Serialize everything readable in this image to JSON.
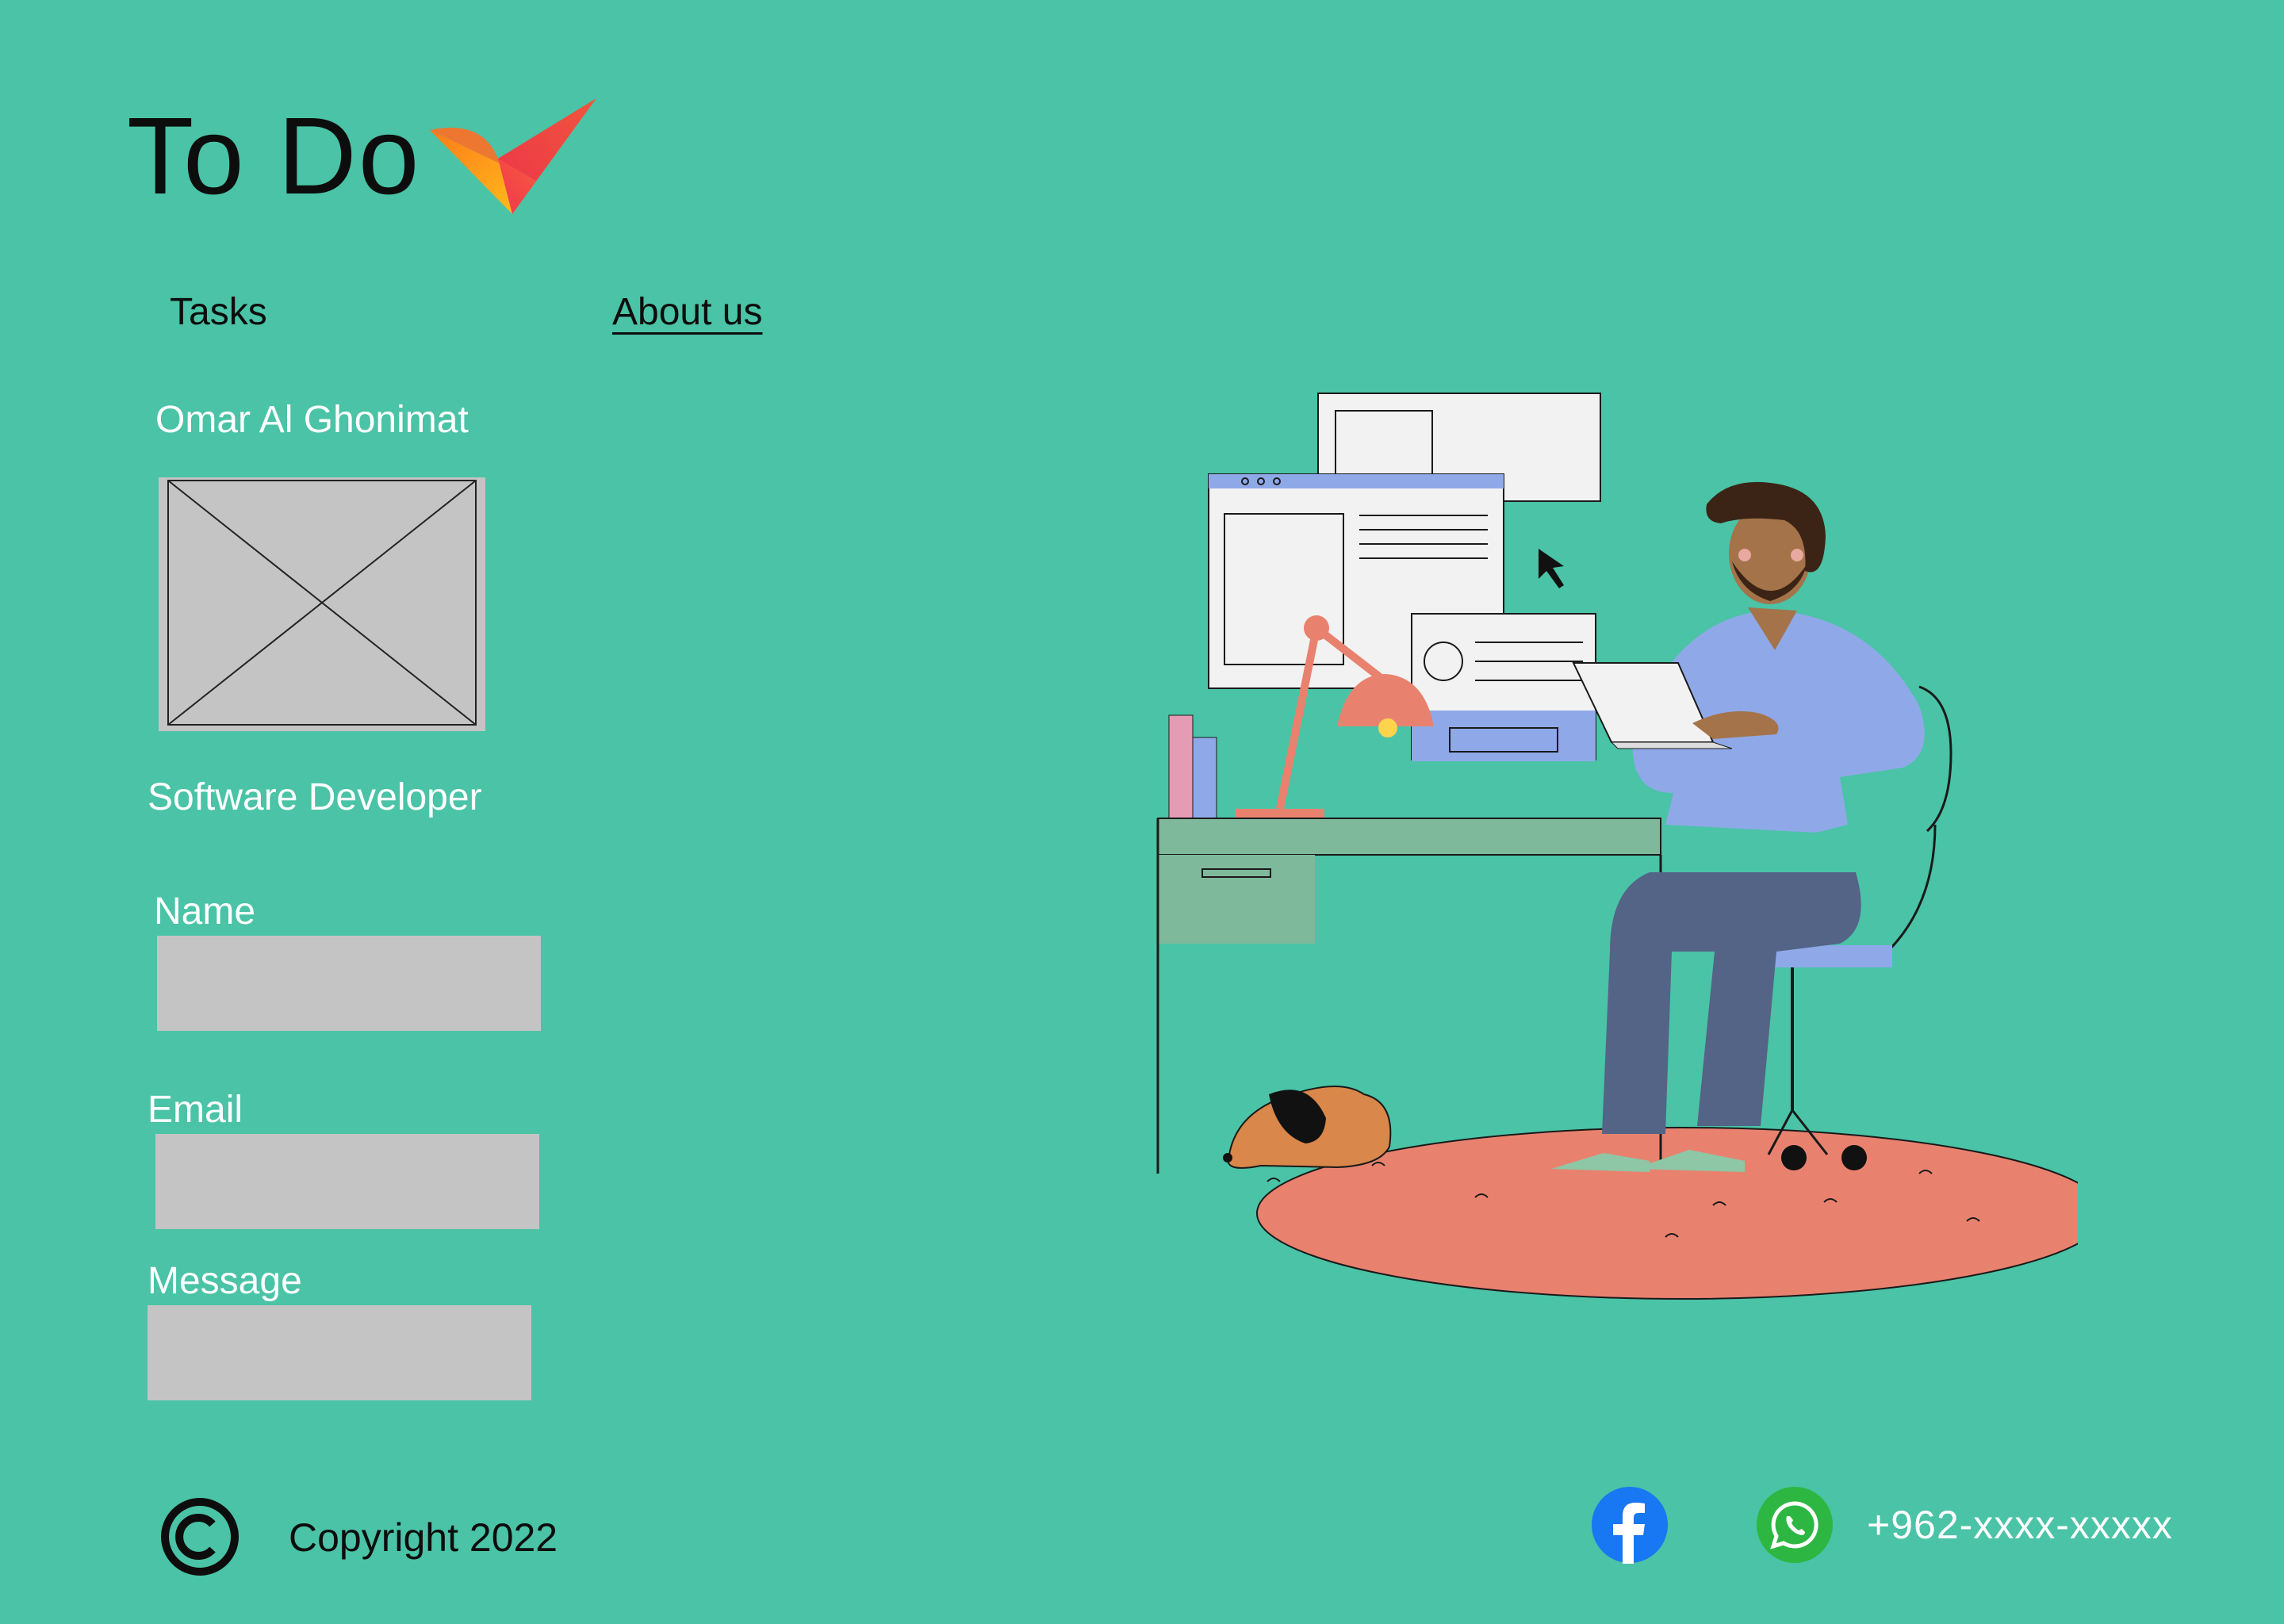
{
  "header": {
    "title": "To Do",
    "logo_icon": "checkmark-logo-icon"
  },
  "nav": {
    "items": [
      {
        "label": "Tasks"
      },
      {
        "label": "About us",
        "active": true
      }
    ]
  },
  "profile": {
    "name": "Omar Al Ghonimat",
    "role": "Software Developer",
    "photo_icon": "image-placeholder-icon"
  },
  "form": {
    "name_label": "Name",
    "name_value": "",
    "email_label": "Email",
    "email_value": "",
    "message_label": "Message",
    "message_value": ""
  },
  "footer": {
    "copyright_icon": "copyright-icon",
    "copyright_text": "Copyright 2022",
    "facebook_icon": "facebook-icon",
    "whatsapp_icon": "whatsapp-icon",
    "phone": "+962-xxxx-xxxxx"
  },
  "colors": {
    "background": "#4AC3A6",
    "placeholder_gray": "#C4C4C4",
    "text_dark": "#0d0d0d",
    "text_light": "#ffffff",
    "facebook_blue": "#1877F2",
    "whatsapp_green": "#2DB742"
  }
}
